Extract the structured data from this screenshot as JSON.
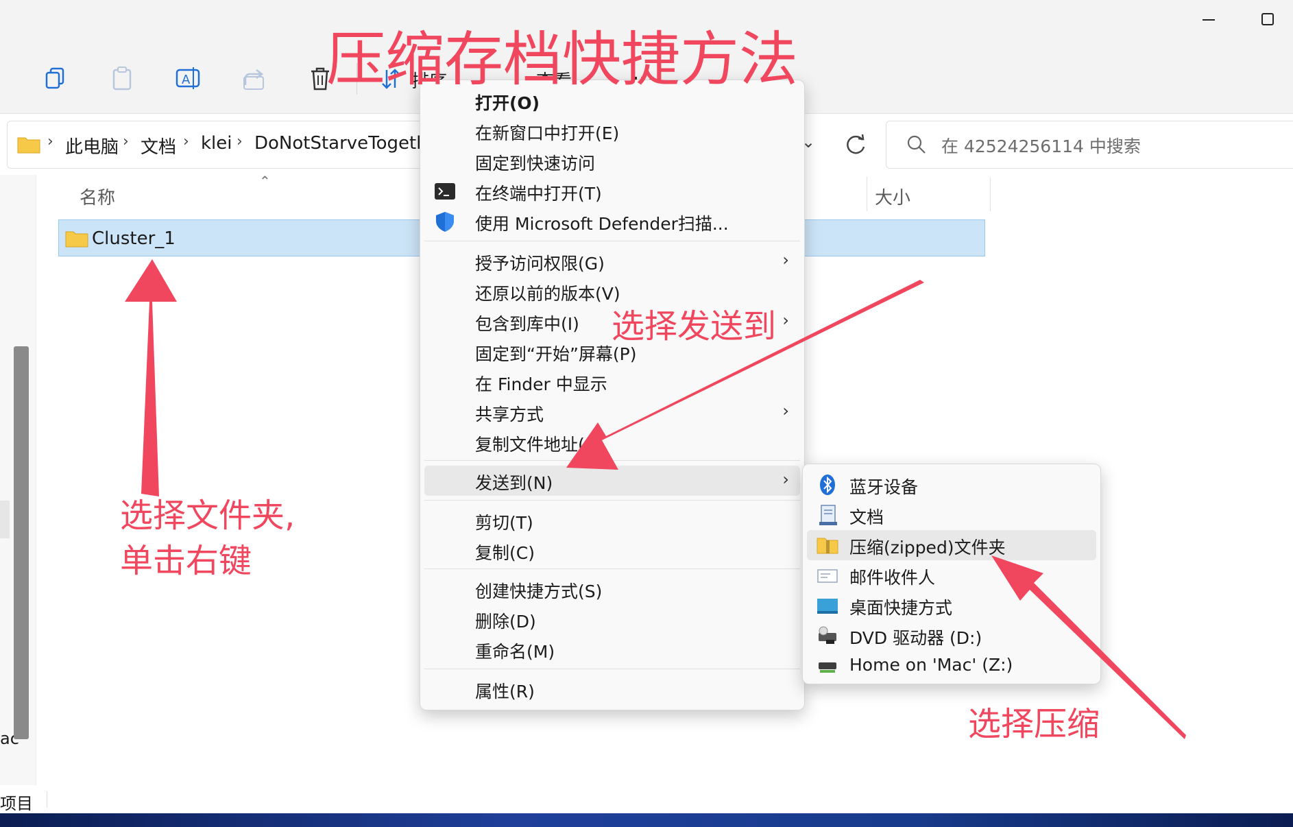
{
  "toolbar": {
    "sort_label": "排序",
    "view_label": "查看",
    "more_label": "..."
  },
  "address": {
    "crumbs": [
      "此电脑",
      "文档",
      "klei",
      "DoNotStarveTogethe"
    ]
  },
  "search": {
    "placeholder": "在 42524256114 中搜索"
  },
  "columns": {
    "name": "名称",
    "size": "大小"
  },
  "files": [
    {
      "name": "Cluster_1",
      "icon": "folder-icon",
      "selected": true
    }
  ],
  "left_nav": {
    "partial_label": "ac"
  },
  "status": {
    "items_label": "项目"
  },
  "context_menu": {
    "items": [
      {
        "label": "打开(O)",
        "bold": true
      },
      {
        "label": "在新窗口中打开(E)"
      },
      {
        "label": "固定到快速访问"
      },
      {
        "label": "在终端中打开(T)",
        "icon": "terminal-icon"
      },
      {
        "label": "使用 Microsoft Defender扫描...",
        "icon": "shield-icon"
      },
      {
        "label": "授予访问权限(G)",
        "submenu": true
      },
      {
        "label": "还原以前的版本(V)"
      },
      {
        "label": "包含到库中(I)",
        "submenu": true
      },
      {
        "label": "固定到“开始”屏幕(P)"
      },
      {
        "label": "在 Finder 中显示"
      },
      {
        "label": "共享方式",
        "submenu": true
      },
      {
        "label": "复制文件地址(A)"
      },
      {
        "label": "发送到(N)",
        "submenu": true,
        "highlighted": true
      },
      {
        "label": "剪切(T)"
      },
      {
        "label": "复制(C)"
      },
      {
        "label": "创建快捷方式(S)"
      },
      {
        "label": "删除(D)"
      },
      {
        "label": "重命名(M)"
      },
      {
        "label": "属性(R)"
      }
    ]
  },
  "send_to_menu": {
    "items": [
      {
        "label": "蓝牙设备",
        "icon": "bluetooth-icon"
      },
      {
        "label": "文档",
        "icon": "documents-icon"
      },
      {
        "label": "压缩(zipped)文件夹",
        "icon": "zip-folder-icon",
        "highlighted": true
      },
      {
        "label": "邮件收件人",
        "icon": "mail-icon"
      },
      {
        "label": "桌面快捷方式",
        "icon": "desktop-icon"
      },
      {
        "label": "DVD 驱动器 (D:)",
        "icon": "dvd-drive-icon"
      },
      {
        "label": "Home on 'Mac' (Z:)",
        "icon": "network-drive-icon"
      }
    ]
  },
  "annotations": {
    "title": "压缩存档快捷方法",
    "step1_line1": "选择文件夹,",
    "step1_line2": "单击右键",
    "step2": "选择发送到",
    "step3": "选择压缩"
  },
  "colors": {
    "annotation": "#f0475e",
    "selection": "#cce4f7",
    "menu_bg": "#f9f9f9",
    "menu_highlight": "#e8e8e8"
  }
}
